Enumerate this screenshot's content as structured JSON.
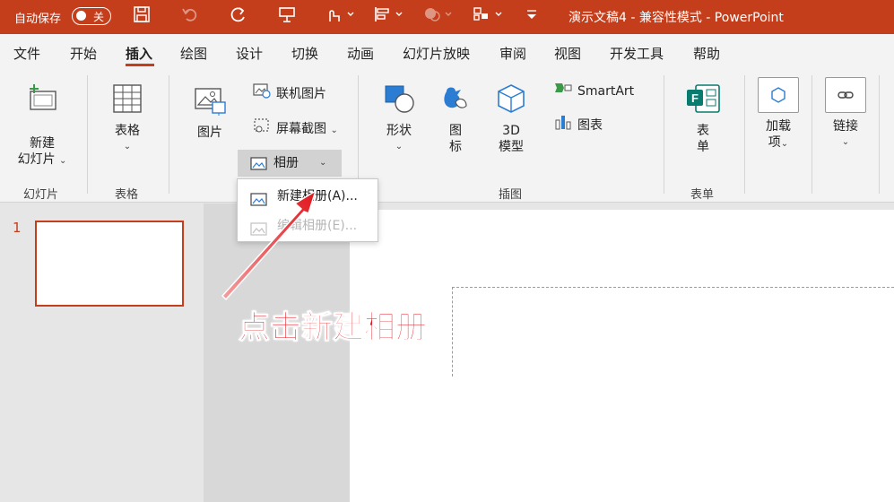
{
  "titlebar": {
    "autosave_label": "自动保存",
    "autosave_state": "关",
    "title": "演示文稿4 - 兼容性模式 - PowerPoint",
    "accent_color": "#c43e1c"
  },
  "tabs": [
    "文件",
    "开始",
    "插入",
    "绘图",
    "设计",
    "切换",
    "动画",
    "幻灯片放映",
    "审阅",
    "视图",
    "开发工具",
    "帮助"
  ],
  "active_tab": "插入",
  "ribbon": {
    "slides_group": {
      "new_slide_line1": "新建",
      "new_slide_line2": "幻灯片",
      "label": "幻灯片"
    },
    "tables_group": {
      "table_btn": "表格",
      "label": "表格"
    },
    "images_group": {
      "pictures_btn": "图片",
      "online_pictures": "联机图片",
      "screenshot": "屏幕截图",
      "album": "相册"
    },
    "illustrations_group": {
      "shapes_btn": "形状",
      "icons_line1": "图",
      "icons_line2": "标",
      "model_line1": "3D",
      "model_line2": "模型",
      "smartart": "SmartArt",
      "chart": "图表",
      "label": "插图"
    },
    "forms_group": {
      "form_line1": "表",
      "form_line2": "单",
      "label": "表单"
    },
    "addins_group": {
      "line1": "加载",
      "line2": "项"
    },
    "links_group": {
      "line1": "链接"
    }
  },
  "album_menu": {
    "new_album": "新建相册(A)...",
    "edit_album": "编辑相册(E)..."
  },
  "slides": {
    "number": "1"
  },
  "annotation": {
    "text": "点击新建相册"
  }
}
